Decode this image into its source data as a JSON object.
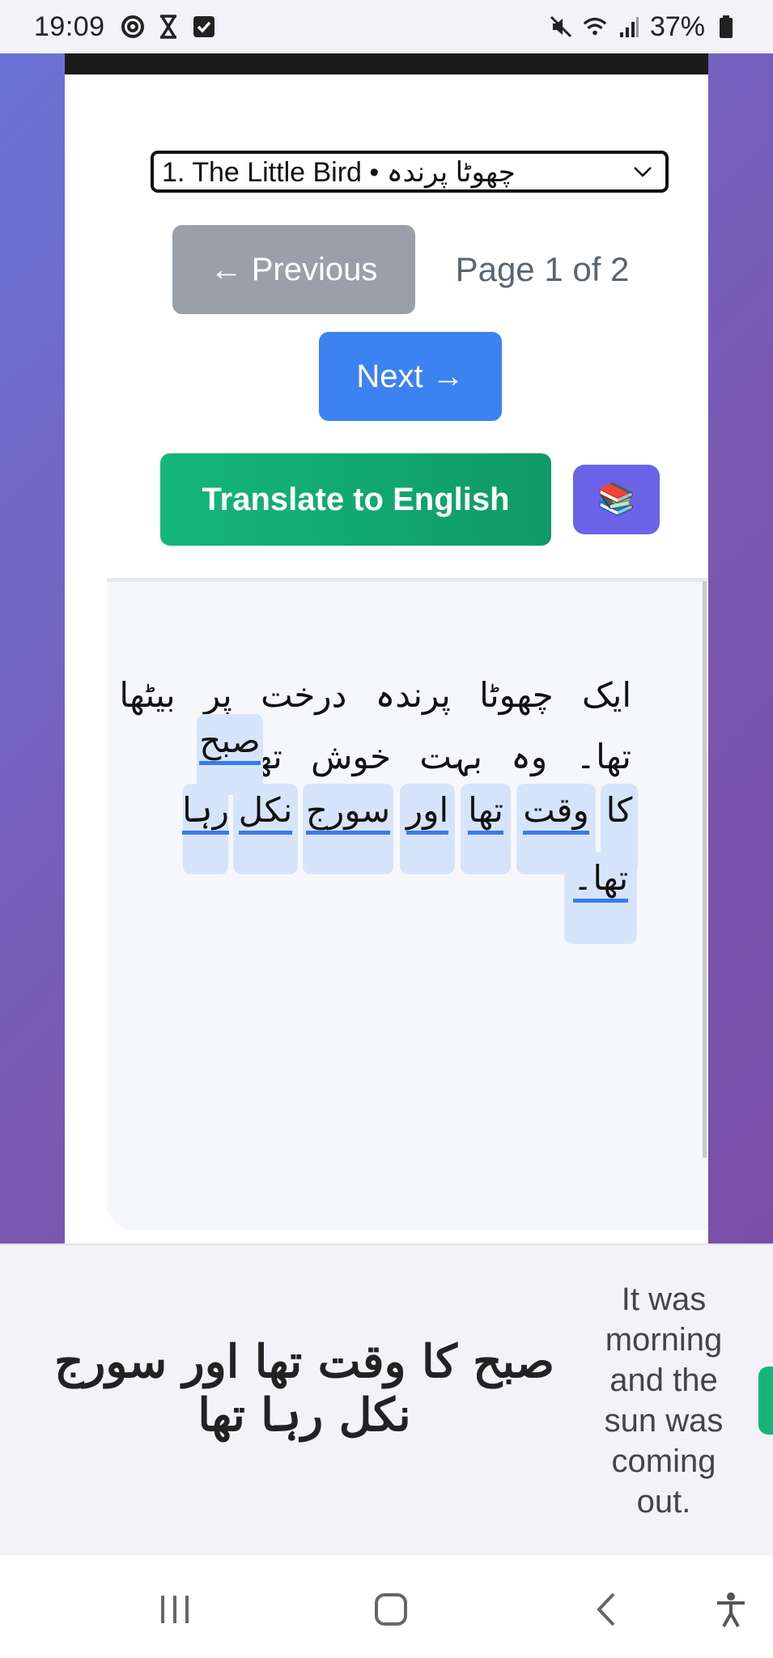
{
  "status_bar": {
    "time": "19:09",
    "battery": "37%",
    "left_icons": [
      "at-sign-icon",
      "hourglass-icon",
      "checkbox-icon"
    ],
    "right_icons": [
      "mute-icon",
      "wifi-icon",
      "signal-icon",
      "battery-icon"
    ]
  },
  "reader": {
    "story_select": {
      "value": "1. The Little Bird • چھوٹا پرندہ"
    },
    "prev_label": "← Previous",
    "page_indicator": "Page 1 of 2",
    "next_label": "Next →",
    "translate_label": "Translate to English",
    "books_icon": "📚"
  },
  "passage": {
    "line1": "ایک چھوٹا پرندہ درخت پر بیٹھا",
    "line2": "تھا۔ وہ بہت خوش تھا۔",
    "words": [
      {
        "text": "صبح"
      },
      {
        "text": "کا"
      },
      {
        "text": "وقت"
      },
      {
        "text": "تھا"
      },
      {
        "text": "اور"
      },
      {
        "text": "سورج"
      },
      {
        "text": "نکل"
      },
      {
        "text": "رہا"
      },
      {
        "text": "تھا۔"
      }
    ]
  },
  "translation_card": {
    "urdu": "صبح کا وقت تھا اور سورج نکل رہا تھا",
    "english": "It was morning and the sun was coming out."
  },
  "nav": {
    "items": [
      "recent-apps-icon",
      "home-icon",
      "back-icon",
      "accessibility-icon"
    ]
  },
  "colors": {
    "accent_blue": "#3c82f0",
    "accent_green": "#14b67c",
    "books_button": "#6a63e8",
    "chip_bg": "#d6e4fb"
  }
}
